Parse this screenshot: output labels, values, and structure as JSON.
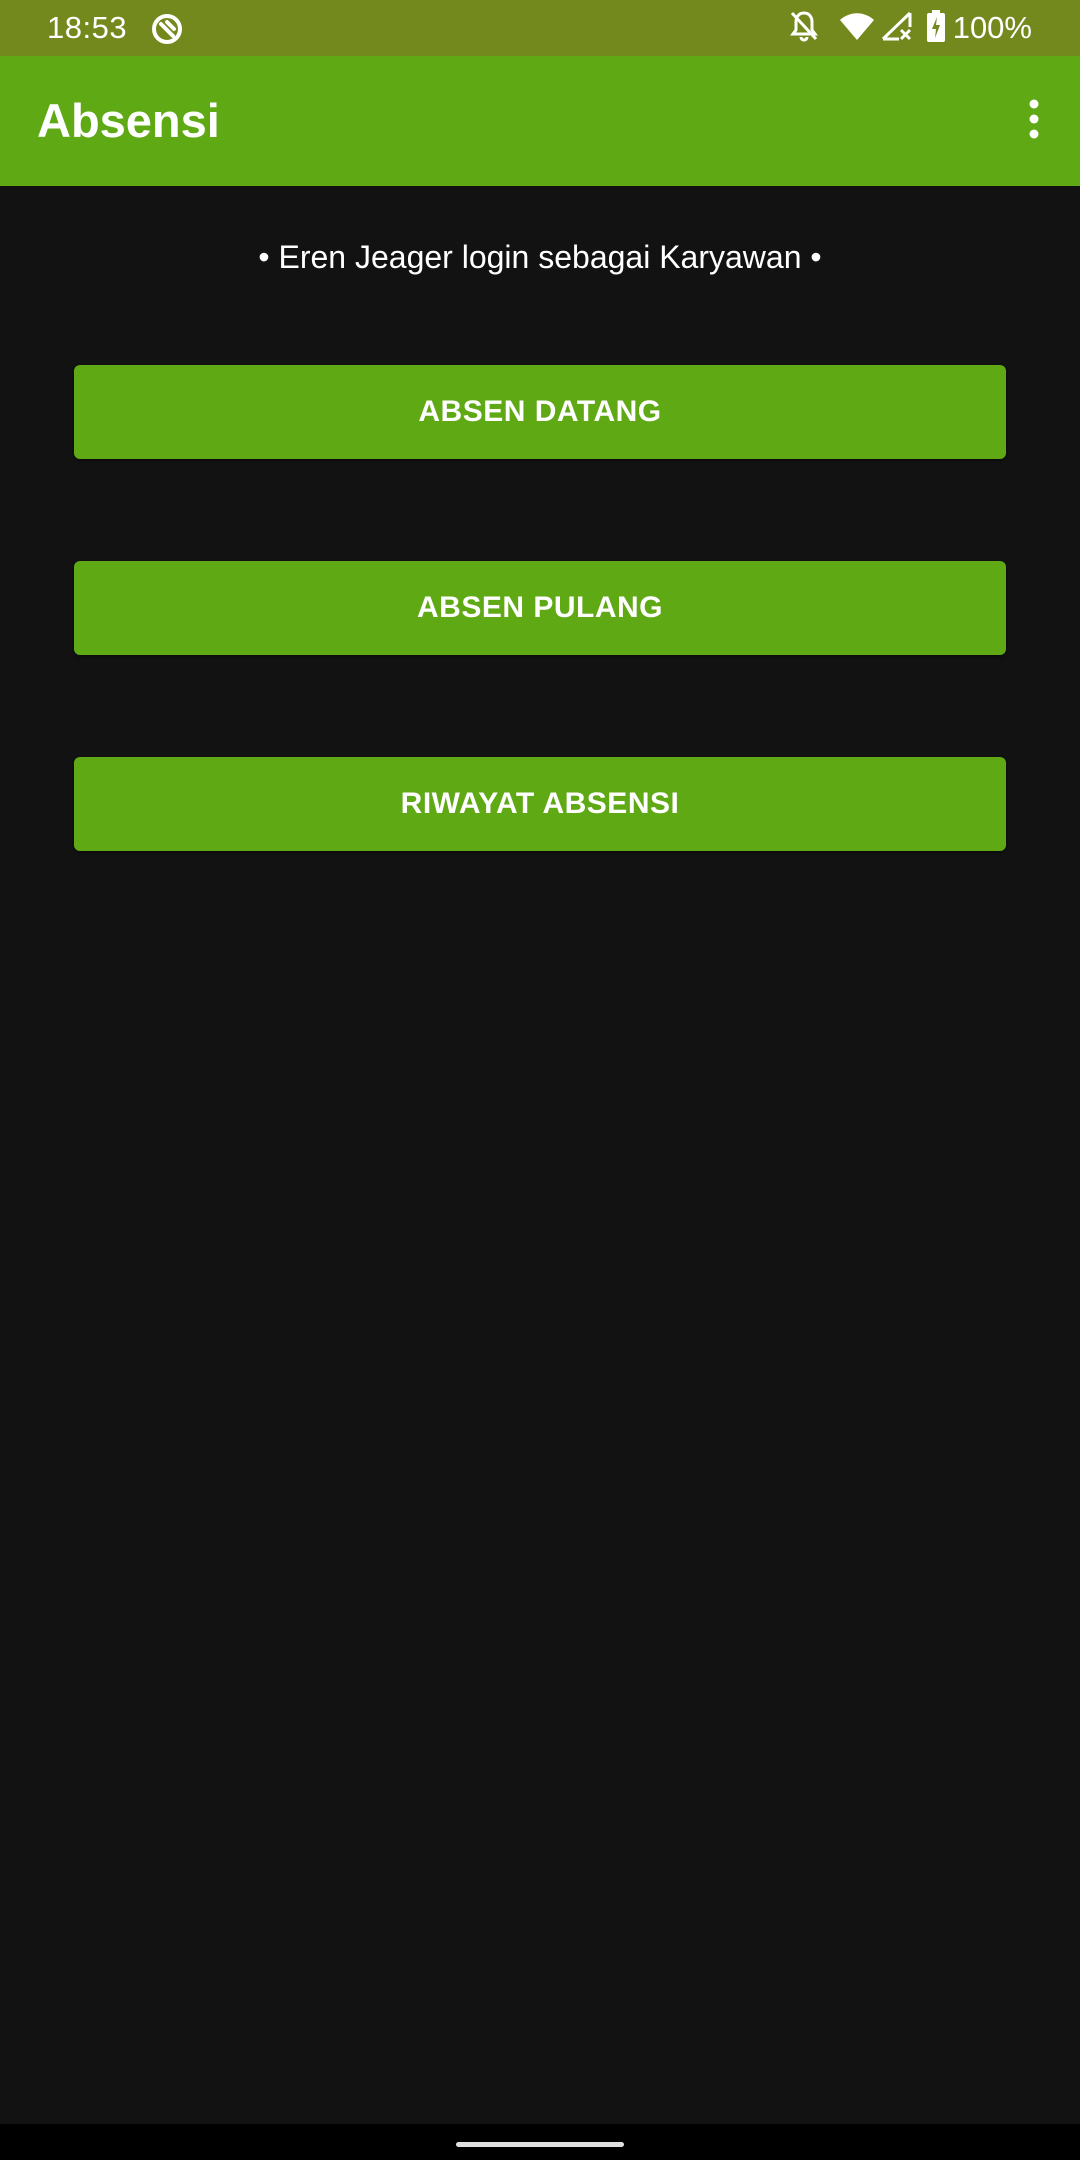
{
  "status_bar": {
    "time": "18:53",
    "battery": "100%",
    "icons": [
      "sync-app-icon",
      "notifications-off-icon",
      "wifi-icon",
      "signal-no-data-icon",
      "battery-charging-icon"
    ]
  },
  "app_bar": {
    "title": "Absensi",
    "menu_icon": "more-vert-icon"
  },
  "main": {
    "greeting": "• Eren Jeager login sebagai Karyawan •",
    "buttons": [
      {
        "label": "ABSEN DATANG"
      },
      {
        "label": "ABSEN PULANG"
      },
      {
        "label": "RIWAYAT ABSENSI"
      }
    ]
  },
  "colors": {
    "status_bar": "#74891d",
    "primary": "#5fa915",
    "background": "#121212",
    "text": "#ffffff"
  }
}
